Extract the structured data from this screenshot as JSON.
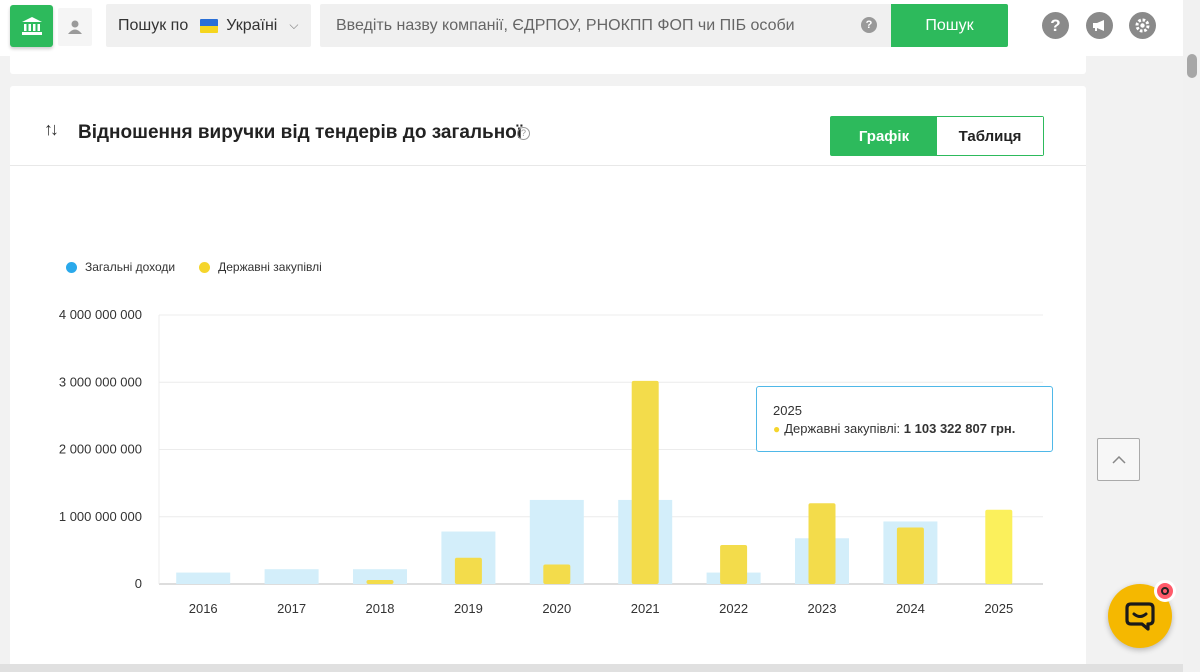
{
  "header": {
    "region_prefix": "Пошук по",
    "region_value": "Україні",
    "search_placeholder": "Введіть назву компанії, ЄДРПОУ, РНОКПП ФОП чи ПІБ особи",
    "search_button": "Пошук",
    "help_icon": "question-icon",
    "announce_icon": "megaphone-icon",
    "settings_icon": "gear-icon"
  },
  "card": {
    "title": "Відношення виручки від тендерів до загальної",
    "view_toggle": {
      "chart_label": "Графік",
      "table_label": "Таблиця",
      "active": "chart"
    }
  },
  "chart_data": {
    "type": "bar",
    "categories": [
      "2016",
      "2017",
      "2018",
      "2019",
      "2020",
      "2021",
      "2022",
      "2023",
      "2024",
      "2025"
    ],
    "series": [
      {
        "name": "Загальні доходи",
        "color": "#d3eefa",
        "values": [
          170000000,
          220000000,
          220000000,
          780000000,
          1250000000,
          1250000000,
          170000000,
          680000000,
          930000000,
          0
        ]
      },
      {
        "name": "Державні закупівлі",
        "color": "#f3dc4b",
        "values": [
          0,
          0,
          60000000,
          390000000,
          290000000,
          3020000000,
          580000000,
          1200000000,
          840000000,
          1103322807
        ]
      }
    ],
    "y_ticks": [
      "0",
      "1 000 000 000",
      "2 000 000 000",
      "3 000 000 000",
      "4 000 000 000"
    ],
    "ylim": [
      0,
      4000000000
    ],
    "legend_placement": "top-left",
    "grid": true,
    "legend_colors": {
      "total": "#2aa9eb",
      "procurement": "#f5d52c"
    },
    "tooltip": {
      "year": "2025",
      "label": "Державні закупівлі:",
      "value": "1 103 322 807 грн."
    }
  }
}
